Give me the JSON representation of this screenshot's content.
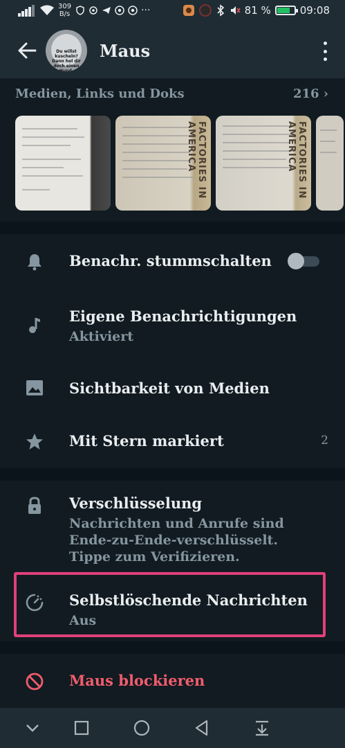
{
  "status_bar": {
    "speed_value": "309",
    "speed_unit": "B/s",
    "battery_percent": "81 %",
    "battery_level": 0.81,
    "time": "09:08"
  },
  "header": {
    "title": "Maus",
    "avatar_text": "Du willst kuscheln? Dann hol dir doch einen Hund."
  },
  "media": {
    "label": "Medien, Links und Doks",
    "count": "216",
    "thumbnail_texts": [
      "FACTORIES IN AMERICA",
      "FACTORIES IN AMERICA"
    ]
  },
  "settings": {
    "mute": {
      "title": "Benachr. stummschalten",
      "toggle_on": false
    },
    "custom_notifications": {
      "title": "Eigene Benachrichtigungen",
      "subtitle": "Aktiviert"
    },
    "media_visibility": {
      "title": "Sichtbarkeit von Medien"
    },
    "starred": {
      "title": "Mit Stern markiert",
      "count": "2"
    }
  },
  "security": {
    "encryption": {
      "title": "Verschlüsselung",
      "subtitle_lines": [
        "Nachrichten und Anrufe sind",
        "Ende-zu-Ende-verschlüsselt.",
        "Tippe zum Verifizieren."
      ]
    },
    "disappearing": {
      "title": "Selbstlöschende Nachrichten",
      "subtitle": "Aus"
    }
  },
  "actions": {
    "block": {
      "title": "Maus blockieren"
    }
  },
  "colors": {
    "background": "#0b141a",
    "surface": "#111b21",
    "header": "#1f2c34",
    "highlight": "#e0407a",
    "danger": "#f15c6d",
    "secondary_text": "#8696a0"
  }
}
